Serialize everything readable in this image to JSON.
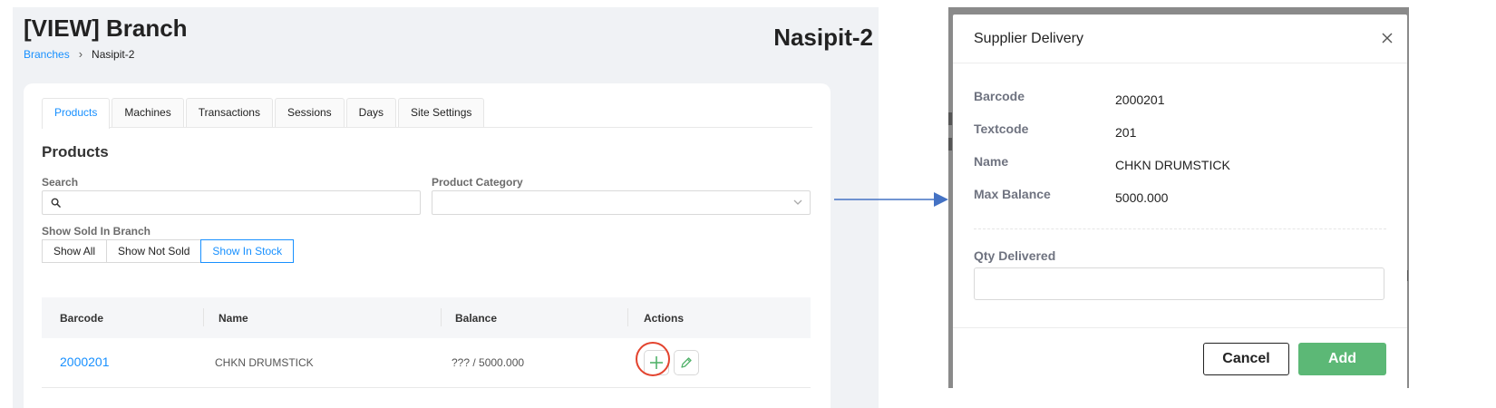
{
  "page": {
    "title": "[VIEW] Branch",
    "branch_name": "Nasipit-2",
    "breadcrumb": {
      "link": "Branches",
      "separator": "›",
      "current": "Nasipit-2"
    }
  },
  "tabs": [
    "Products",
    "Machines",
    "Transactions",
    "Sessions",
    "Days",
    "Site Settings"
  ],
  "active_tab": "Products",
  "products": {
    "title": "Products",
    "search_label": "Search",
    "search_value": "",
    "category_label": "Product Category",
    "category_value": "",
    "filter_label": "Show Sold In Branch",
    "filters": [
      "Show All",
      "Show Not Sold",
      "Show In Stock"
    ],
    "active_filter": "Show In Stock"
  },
  "table": {
    "columns": [
      "Barcode",
      "Name",
      "Balance",
      "Actions"
    ],
    "rows": [
      {
        "barcode": "2000201",
        "name": "CHKN DRUMSTICK",
        "balance": "??? / 5000.000"
      }
    ]
  },
  "modal": {
    "title": "Supplier Delivery",
    "fields": [
      {
        "label": "Barcode",
        "value": "2000201"
      },
      {
        "label": "Textcode",
        "value": "201"
      },
      {
        "label": "Name",
        "value": "CHKN DRUMSTICK"
      },
      {
        "label": "Max Balance",
        "value": "5000.000"
      }
    ],
    "qty_label": "Qty Delivered",
    "qty_value": "",
    "cancel_label": "Cancel",
    "add_label": "Add"
  },
  "colors": {
    "accent": "#1890ff",
    "add_button": "#5cb876",
    "highlight_ring": "#e3432e",
    "arrow": "#4472c4"
  },
  "icons": [
    "search-icon",
    "chevron-down-icon",
    "plus-icon",
    "pencil-icon",
    "close-icon",
    "arrow-right-icon"
  ]
}
